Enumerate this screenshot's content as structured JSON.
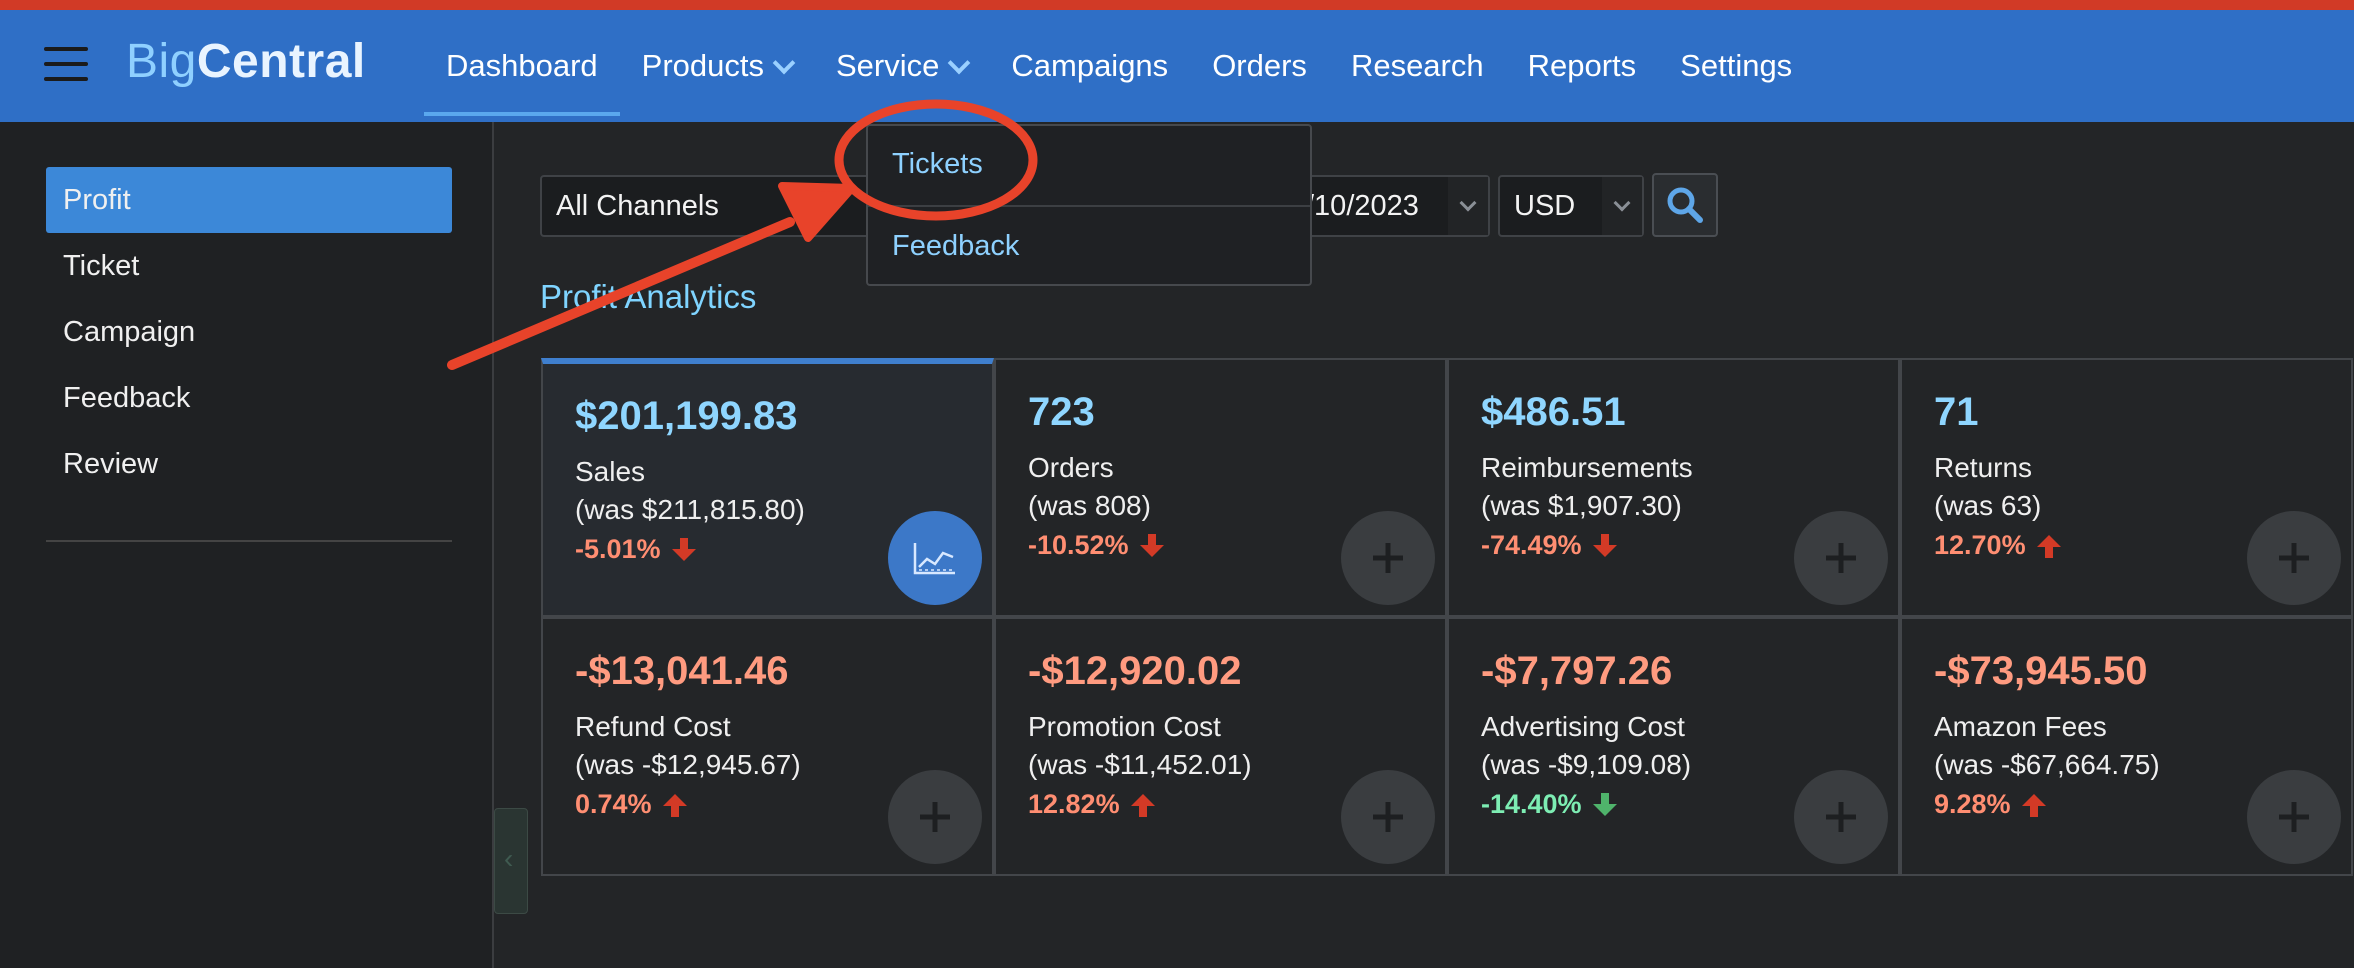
{
  "app": {
    "logo_part1": "Big",
    "logo_part2": "Central"
  },
  "nav": {
    "items": [
      {
        "label": "Dashboard"
      },
      {
        "label": "Products"
      },
      {
        "label": "Service"
      },
      {
        "label": "Campaigns"
      },
      {
        "label": "Orders"
      },
      {
        "label": "Research"
      },
      {
        "label": "Reports"
      },
      {
        "label": "Settings"
      }
    ],
    "active": "Dashboard"
  },
  "service_dropdown": {
    "options": [
      {
        "label": "Tickets"
      },
      {
        "label": "Feedback"
      }
    ]
  },
  "sidebar": {
    "items": [
      {
        "label": "Profit"
      },
      {
        "label": "Ticket"
      },
      {
        "label": "Campaign"
      },
      {
        "label": "Feedback"
      },
      {
        "label": "Review"
      }
    ],
    "active": "Profit"
  },
  "filters": {
    "channel": "All Channels",
    "date_partial": "/10/2023",
    "currency": "USD"
  },
  "section_title": "Profit Analytics",
  "metrics": [
    {
      "value": "$201,199.83",
      "label": "Sales",
      "was": "(was $211,815.80)",
      "change": "-5.01%",
      "trend": "down",
      "kind": "pos",
      "tone": "bad",
      "button": "chart-icon"
    },
    {
      "value": "723",
      "label": "Orders",
      "was": "(was 808)",
      "change": "-10.52%",
      "trend": "down",
      "kind": "pos",
      "tone": "bad",
      "button": "plus-icon"
    },
    {
      "value": "$486.51",
      "label": "Reimbursements",
      "was": "(was $1,907.30)",
      "change": "-74.49%",
      "trend": "down",
      "kind": "pos",
      "tone": "bad",
      "button": "plus-icon"
    },
    {
      "value": "71",
      "label": "Returns",
      "was": "(was 63)",
      "change": "12.70%",
      "trend": "up",
      "kind": "pos",
      "tone": "bad",
      "button": "plus-icon"
    },
    {
      "value": "-$13,041.46",
      "label": "Refund Cost",
      "was": "(was -$12,945.67)",
      "change": "0.74%",
      "trend": "up",
      "kind": "neg",
      "tone": "bad",
      "button": "plus-icon"
    },
    {
      "value": "-$12,920.02",
      "label": "Promotion Cost",
      "was": "(was -$11,452.01)",
      "change": "12.82%",
      "trend": "up",
      "kind": "neg",
      "tone": "bad",
      "button": "plus-icon"
    },
    {
      "value": "-$7,797.26",
      "label": "Advertising Cost",
      "was": "(was -$9,109.08)",
      "change": "-14.40%",
      "trend": "down",
      "kind": "neg",
      "tone": "good",
      "button": "plus-icon"
    },
    {
      "value": "-$73,945.50",
      "label": "Amazon Fees",
      "was": "(was -$67,664.75)",
      "change": "9.28%",
      "trend": "up",
      "kind": "neg",
      "tone": "bad",
      "button": "plus-icon"
    }
  ],
  "colors": {
    "topbar": "#2f6fc6",
    "accent_stripe": "#d13a26",
    "annotation": "#e8432a",
    "trend_bad": "#d33a26",
    "trend_good": "#4fb36b"
  }
}
